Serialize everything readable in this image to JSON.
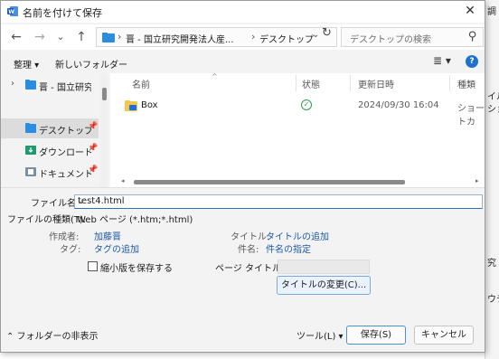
{
  "window": {
    "title": "名前を付けて保存",
    "close_glyph": "✕"
  },
  "nav_buttons": {
    "back": "←",
    "forward": "→",
    "recent": "⌄",
    "up": "↑"
  },
  "address": {
    "crumb_1": "晋 - 国立研究開発法人産...",
    "crumb_2": "デスクトップ",
    "separator": "›",
    "dropdown": "⌄",
    "refresh": "↻"
  },
  "search": {
    "placeholder": "デスクトップの検索",
    "icon": "⚲"
  },
  "toolbar": {
    "organize": "整理 ▾",
    "new_folder": "新しいフォルダー",
    "view_icon": "≣ ▾",
    "help": "?"
  },
  "sidebar": {
    "items": [
      {
        "label": "晋 - 国立研究開発",
        "icon": "cloud-folder-icon",
        "chevron": "›",
        "pin": ""
      },
      {
        "label": "デスクトップ",
        "icon": "desktop-folder-icon",
        "chevron": "",
        "pin": "📌"
      },
      {
        "label": "ダウンロード",
        "icon": "download-folder-icon",
        "chevron": "",
        "pin": "📌"
      },
      {
        "label": "ドキュメント",
        "icon": "documents-folder-icon",
        "chevron": "",
        "pin": "📌"
      }
    ]
  },
  "filelist": {
    "columns": {
      "name": "名前",
      "status": "状態",
      "modified": "更新日時",
      "type": "種類"
    },
    "sort_caret": "^",
    "rows": [
      {
        "name": "Box",
        "status_icon": "✓",
        "modified": "2024/09/30 16:04",
        "type": "ショートカ"
      }
    ],
    "scroll_left": "◂",
    "scroll_right": "▸"
  },
  "form": {
    "filename_label": "ファイル名(N):",
    "filename_value": "test4.html",
    "filetype_label": "ファイルの種類(T):",
    "filetype_value": "Web ページ (*.htm;*.html)",
    "dropdown_caret": "⌄",
    "author_label": "作成者:",
    "author_value": "加藤晋",
    "tags_label": "タグ:",
    "tags_value": "タグの追加",
    "title_label": "タイトル:",
    "title_value": "タイトルの追加",
    "subject_label": "件名:",
    "subject_value": "件名の指定",
    "thumbnail_label": "縮小版を保存する",
    "page_title_label": "ページ タイトル(T):",
    "change_title_button": "タイトルの変更(C)...",
    "hide_folders": "⌃ フォルダーの非表示",
    "tools_button": "ツール(L)  ▾",
    "save_button": "保存(S)",
    "cancel_button": "キャンセル"
  },
  "background_app": {
    "texts": [
      "調",
      "イル",
      "ショ",
      "究・",
      "ウチ"
    ]
  },
  "colors": {
    "accent": "#1f72c9",
    "link": "#1f5aa6",
    "ok": "#2d9e4b",
    "selection": "#dcdcdc"
  }
}
